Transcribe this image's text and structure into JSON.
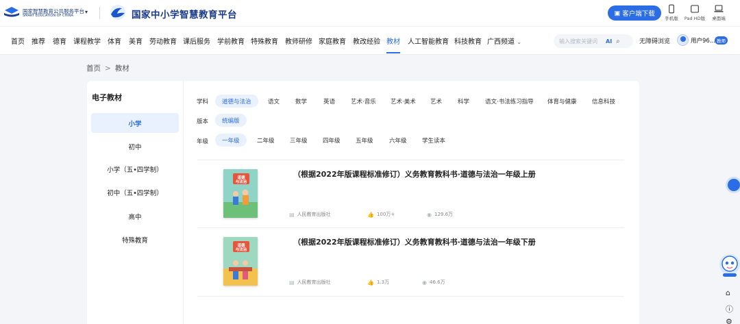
{
  "header": {
    "org_cn": "国家智慧教育公共服务平台",
    "org_en": "SMART EDUCATION OF CHINA",
    "platform_title": "国家中小学智慧教育平台",
    "download_label": "客户端下载",
    "devices": [
      "手机版",
      "Pad HD版",
      "桌面端"
    ]
  },
  "nav": {
    "items": [
      "首页",
      "推荐",
      "德育",
      "课程教学",
      "体育",
      "美育",
      "劳动教育",
      "课后服务",
      "学前教育",
      "特殊教育",
      "教师研修",
      "家庭教育",
      "教改经验",
      "教材",
      "人工智能教育",
      "科技教育",
      "广西频道"
    ],
    "active": "教材",
    "search_placeholder": "输入搜索关键词",
    "ai_label": "AI",
    "accessibility": "无障碍浏览",
    "username": "用户96...",
    "role_badge": "教师"
  },
  "breadcrumb": {
    "home": "首页",
    "sep": ">",
    "current": "教材"
  },
  "sidebar": {
    "title": "电子教材",
    "items": [
      "小学",
      "初中",
      "小学（五•四学制）",
      "初中（五•四学制）",
      "高中",
      "特殊教育"
    ],
    "active": "小学"
  },
  "filters": {
    "subject": {
      "label": "学科",
      "options": [
        "道德与法治",
        "语文",
        "数学",
        "英语",
        "艺术·音乐",
        "艺术·美术",
        "艺术",
        "科学",
        "语文·书法练习指导",
        "体育与健康",
        "信息科技"
      ],
      "selected": "道德与法治"
    },
    "edition": {
      "label": "版本",
      "options": [
        "统编版"
      ],
      "selected": "统编版"
    },
    "grade": {
      "label": "年级",
      "options": [
        "一年级",
        "二年级",
        "三年级",
        "四年级",
        "五年级",
        "六年级",
        "学生读本"
      ],
      "selected": "一年级"
    }
  },
  "books": [
    {
      "title": "（根据2022年版课程标准修订）义务教育教科书·道德与法治一年级上册",
      "publisher": "人民教育出版社",
      "likes": "100万+",
      "views": "129.6万",
      "cover_title": "道德与法治",
      "cover_grade": "一年级 上册"
    },
    {
      "title": "（根据2022年版课程标准修订）义务教育教科书·道德与法治一年级下册",
      "publisher": "人民教育出版社",
      "likes": "1.3万",
      "views": "46.6万",
      "cover_title": "道德与法治",
      "cover_grade": "一年级 下册"
    }
  ],
  "colors": {
    "accent": "#2b6de5",
    "brand": "#1a3a8c",
    "active_bg": "#e9f1fe"
  }
}
